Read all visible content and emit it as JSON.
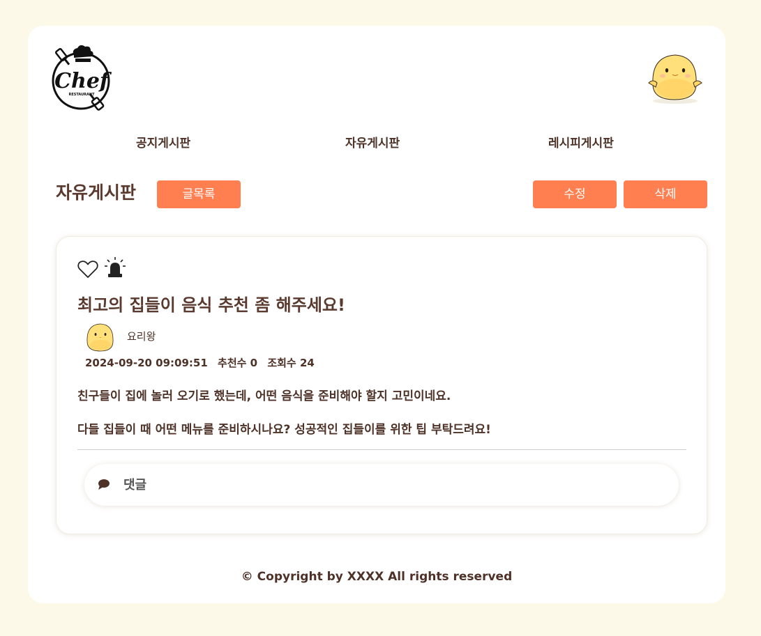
{
  "header": {
    "logo_text": "Chef",
    "logo_subtext": "RESTAURANT"
  },
  "nav": {
    "items": [
      {
        "label": "공지게시판"
      },
      {
        "label": "자유게시판"
      },
      {
        "label": "레시피게시판"
      }
    ]
  },
  "board": {
    "title": "자유게시판",
    "list_button": "글목록",
    "edit_button": "수정",
    "delete_button": "삭제"
  },
  "post": {
    "icons": [
      "heart-icon",
      "siren-icon"
    ],
    "title": "최고의 집들이 음식 추천 좀 해주세요!",
    "author": "요리왕",
    "date": "2024-09-20 09:09:51",
    "recommend_label": "추천수 0",
    "views_label": "조회수 24",
    "body": [
      "친구들이 집에 놀러 오기로 했는데, 어떤 음식을 준비해야 할지 고민이네요.",
      "다들 집들이 때 어떤 메뉴를 준비하시나요? 성공적인 집들이를 위한 팁 부탁드려요!"
    ]
  },
  "comment": {
    "label": "댓글",
    "icon": "speech-bubble-icon"
  },
  "footer": {
    "copyright": "© Copyright by XXXX All rights reserved"
  },
  "colors": {
    "page_background": "#fdf9e8",
    "accent": "#ff7f50",
    "text": "#5a3a2e"
  }
}
